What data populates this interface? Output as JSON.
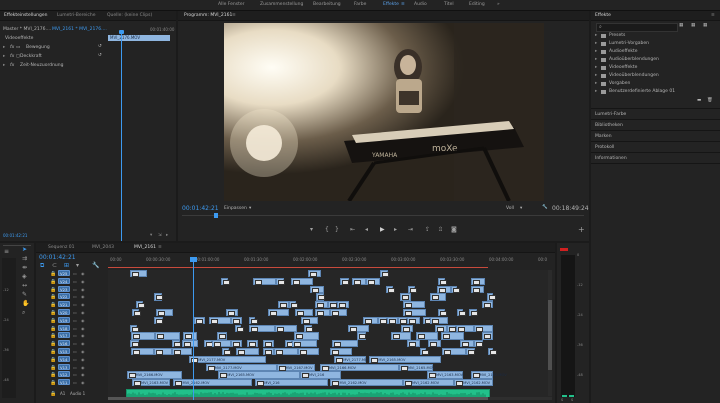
{
  "workspace_tabs": [
    "Alle Fenster",
    "Zusammenstellung",
    "Bearbeitung",
    "Farbe",
    "Effekte",
    "Audio",
    "Titel",
    "Editing"
  ],
  "active_workspace": "Effekte",
  "source_panel": {
    "tabs": [
      "Effekteinstellungen",
      "Lumetri-Bereiche",
      "Quelle: (keine Clips)"
    ],
    "master_label": "Master * MVI_2176....",
    "clip_label": "MVI_2161 * MVI_2176....",
    "timecode_mini": "00:01:40:00",
    "clip_name": "MVI_2176.MOV",
    "section": "Videoeffekte",
    "effects": [
      "Bewegung",
      "Deckkraft",
      "Zeit-Neuzuordnung"
    ],
    "fx_badge": "fx",
    "bottom_timecode": "00:01:42:21"
  },
  "program_monitor": {
    "tab": "Programm: MVI_2161",
    "timecode_left": "00:01:42:21",
    "fit": "Einpassen",
    "quality": "Voll",
    "timecode_right": "00:18:49:24",
    "keyboard_brand_1": "YAMAHA",
    "keyboard_brand_2": "moXe"
  },
  "effects_panel": {
    "title": "Effekte",
    "tree": [
      "Presets",
      "Lumetri-Vorgaben",
      "Audioeffekte",
      "Audioüberblendungen",
      "Videoeffekte",
      "Videoüberblendungen",
      "Vorgaben",
      "Benutzerdefinierte Ablage 01"
    ],
    "collapsed_panels": [
      "Lumetri-Farbe",
      "Bibliotheken",
      "Marken",
      "Protokoll",
      "Informationen"
    ]
  },
  "timeline": {
    "tabs": [
      "Sequenz 01",
      "MVI_2043",
      "MVI_2161"
    ],
    "active_tab": "MVI_2161",
    "timecode": "00:01:42:21",
    "ruler": [
      "00:00",
      "00:00:30:00",
      "00:01:00:00",
      "00:01:30:00",
      "00:02:00:00",
      "00:02:30:00",
      "00:03:00:00",
      "00:03:30:00",
      "00:04:00:00",
      "00:0"
    ],
    "video_tracks": [
      "V25",
      "V24",
      "V23",
      "V22",
      "V21",
      "V20",
      "V19",
      "V18",
      "V17",
      "V16",
      "V15",
      "V14",
      "V13",
      "V12",
      "V11"
    ],
    "audio_track_label": "Audio 1",
    "audio_track_id": "A1",
    "clip_labels": [
      "MVI_2177.MOV",
      "MVI_2177.MOV",
      "MVI_2165.MOV",
      "MVI_2177.MOV",
      "MVI_2167.MOV",
      "MVI_2166.MOV",
      "MVI_2165.MOV",
      "MVI_2166.MOV",
      "MVI_2165.MOV",
      "MVI_216",
      "MVI_2163.MOV",
      "MVI_2162.MOV",
      "MVI_2163.MOV",
      "MVI_2162.MOV",
      "MVI_216",
      "MVI_2162.MOV",
      "MVI_2162.MOV",
      "MVI_2162.MOV"
    ]
  },
  "colors": {
    "accent": "#3d9af0",
    "clip": "#8fb6e0",
    "audio": "#22c08a",
    "panel": "#232323"
  }
}
